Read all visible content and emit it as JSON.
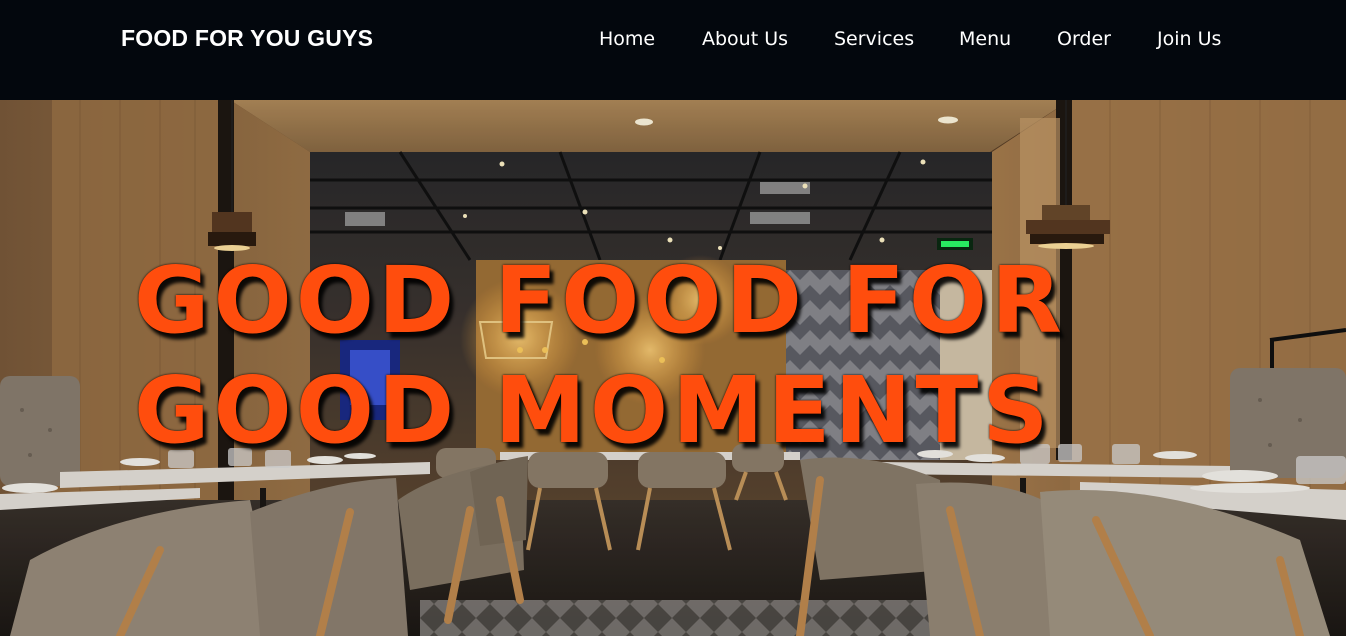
{
  "header": {
    "brand": "FOOD FOR YOU GUYS",
    "nav": [
      "Home",
      "About Us",
      "Services",
      "Menu",
      "Order",
      "Join Us"
    ]
  },
  "hero": {
    "headline_line1": "GOOD FOOD FOR",
    "headline_line2": "GOOD MOMENTS",
    "headline_color": "#ff4d0d",
    "background": "restaurant-interior-photo"
  },
  "colors": {
    "navbar_bg": "#03070d",
    "nav_text": "#ffffff"
  }
}
